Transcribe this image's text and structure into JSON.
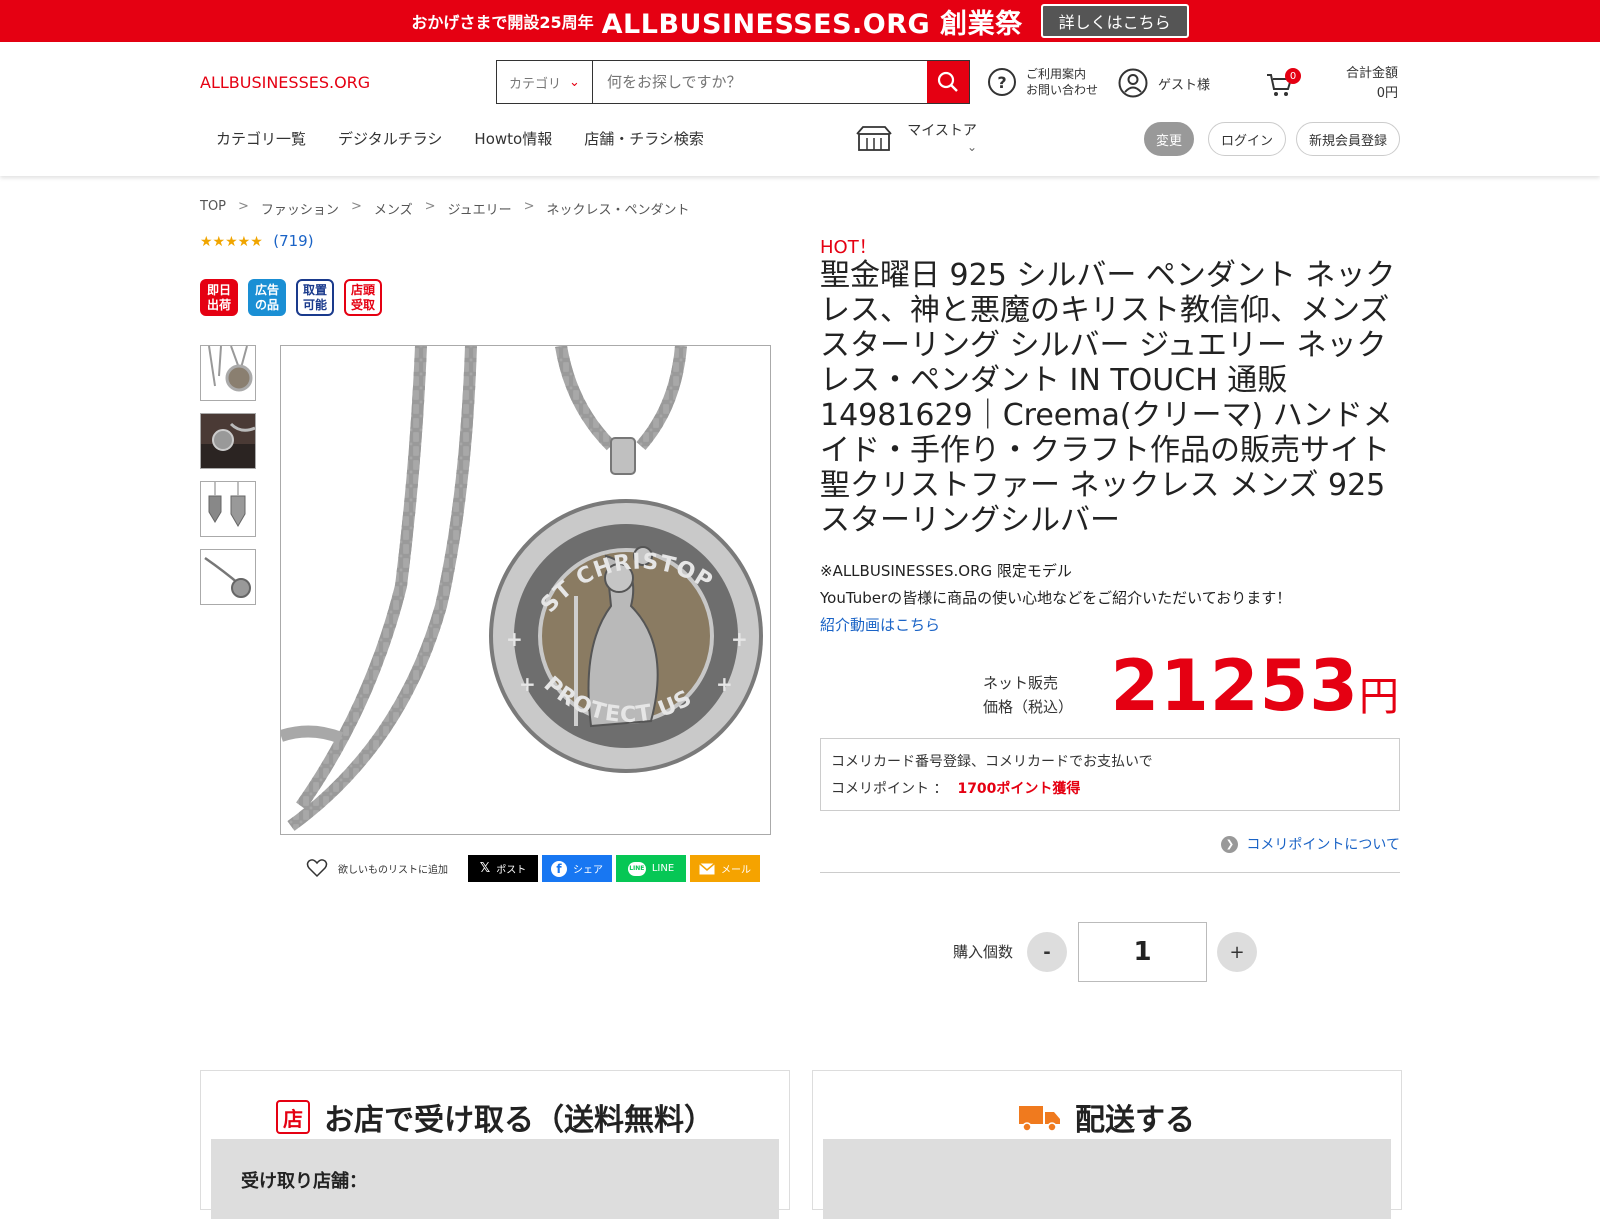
{
  "banner": {
    "small": "おかげさまで開設25周年",
    "big": "ALLBUSINESSES.ORG 創業祭",
    "button": "詳しくはこちら"
  },
  "header": {
    "logo": "ALLBUSINESSES.ORG",
    "search": {
      "category": "カテゴリ",
      "placeholder": "何をお探しですか？"
    },
    "help": {
      "line1": "ご利用案内",
      "line2": "お問い合わせ"
    },
    "user": "ゲスト様",
    "cart_count": "0",
    "total": {
      "label": "合計金額",
      "value": "0円"
    },
    "nav": [
      "カテゴリ一覧",
      "デジタルチラシ",
      "Howto情報",
      "店舗・チラシ検索"
    ],
    "mystore": "マイストア",
    "buttons": {
      "change": "変更",
      "login": "ログイン",
      "register": "新規会員登録"
    }
  },
  "breadcrumb": [
    "TOP",
    "ファッション",
    "メンズ",
    "ジュエリー",
    "ネックレス・ペンダント"
  ],
  "rating": {
    "stars": "★★★★★",
    "count": "(719)"
  },
  "badges": [
    {
      "text": "即日出荷",
      "color": "#e50012"
    },
    {
      "text": "広告の品",
      "color": "#1a8fd4"
    },
    {
      "text": "取置可能",
      "color": "#ffffff"
    },
    {
      "text": "店頭受取",
      "color": "#ffffff"
    }
  ],
  "share": {
    "wishlist": "欲しいものリストに追加",
    "x": "ポスト",
    "facebook": "シェア",
    "line": "LINE",
    "mail": "メール"
  },
  "product": {
    "hot": "HOT！",
    "title": "聖金曜日 925 シルバー ペンダント ネックレス、神と悪魔のキリスト教信仰、メンズ スターリング シルバー ジュエリー ネックレス・ペンダント IN TOUCH 通販 14981629｜Creema(クリーマ) ハンドメイド・手作り・クラフト作品の販売サイト 聖クリストファー ネックレス メンズ 925スターリングシルバー",
    "note": "※ALLBUSINESSES.ORG 限定モデル",
    "youtuber": "YouTuberの皆様に商品の使い心地などをご紹介いただいております！",
    "video_link": "紹介動画はこちら",
    "price_label_1": "ネット販売",
    "price_label_2": "価格（税込）",
    "price": "21253",
    "yen": "円",
    "medal_text_top": "ST CHRISTOPHER",
    "medal_text_bottom": "PROTECT US"
  },
  "points": {
    "line1": "コメリカード番号登録、コメリカードでお支払いで",
    "label": "コメリポイント ：",
    "value": "1700ポイント獲得",
    "about": "コメリポイントについて"
  },
  "quantity": {
    "label": "購入個数",
    "minus": "-",
    "value": "1",
    "plus": "+"
  },
  "delivery": {
    "store": {
      "title": "お店で受け取る（送料無料）",
      "store_label": "受け取り店舗："
    },
    "ship": {
      "title": "配送する"
    }
  }
}
